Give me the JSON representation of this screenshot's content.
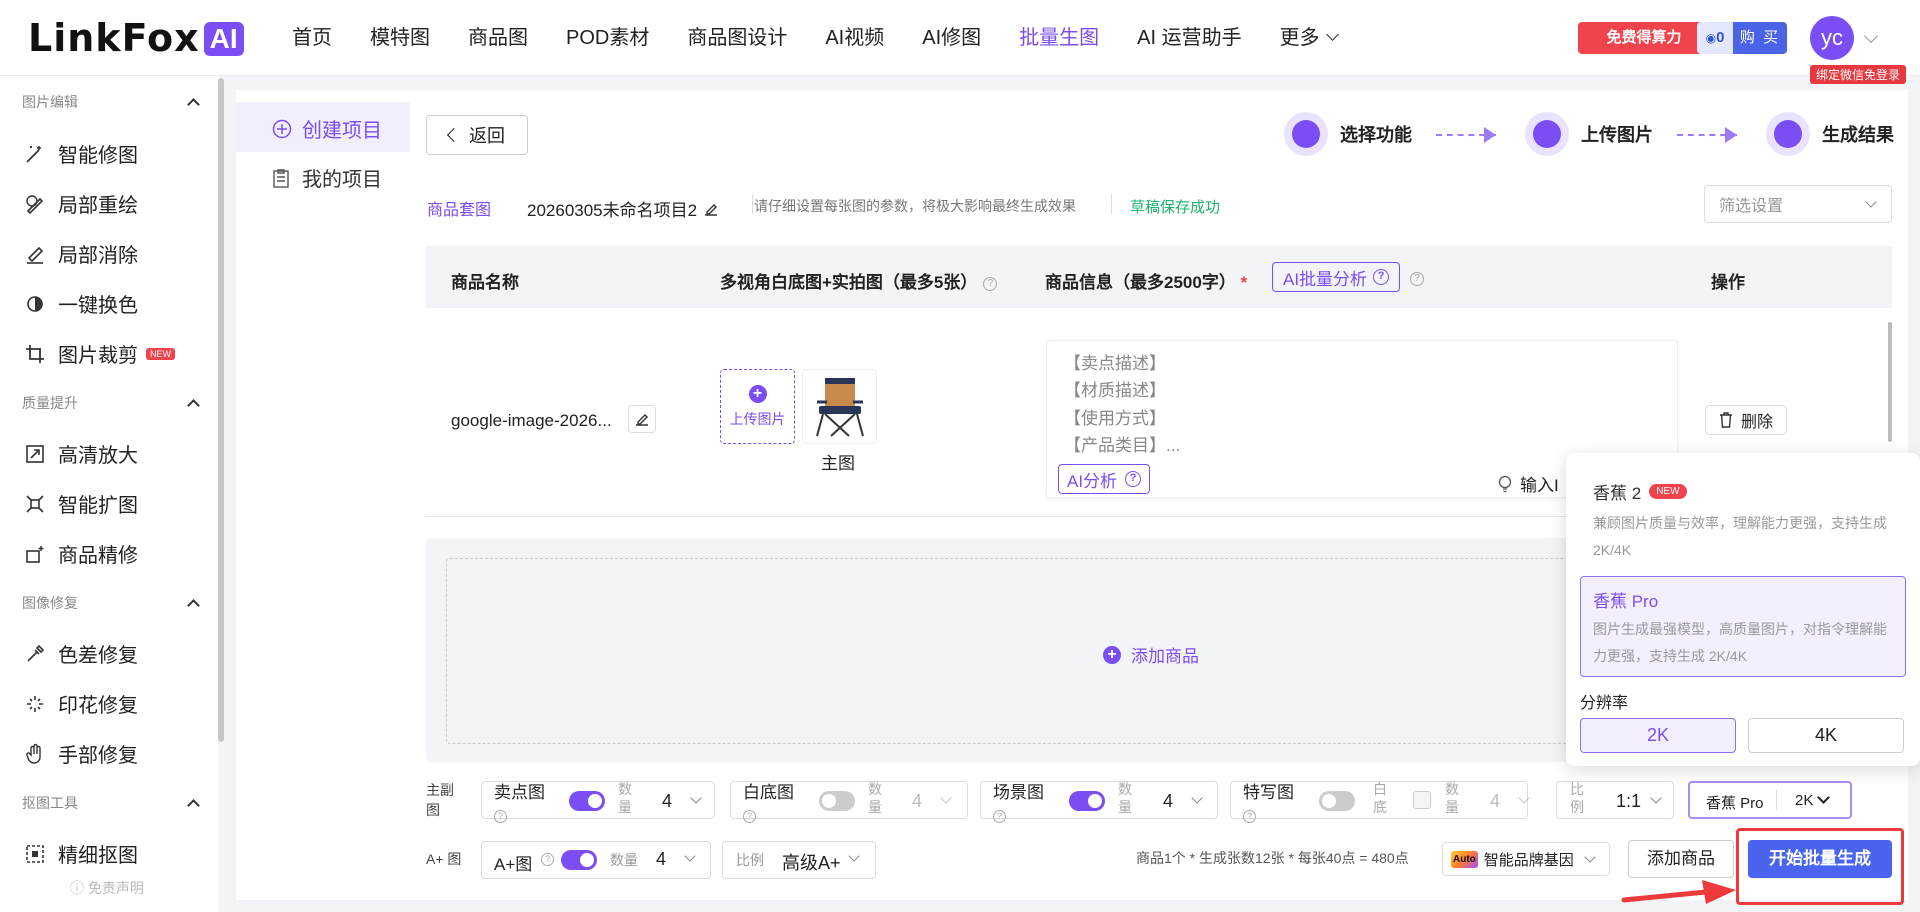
{
  "header": {
    "logo_text": "LinkFox",
    "logo_badge": "AI",
    "nav": [
      "首页",
      "模特图",
      "商品图",
      "POD素材",
      "商品图设计",
      "AI视频",
      "AI修图",
      "批量生图",
      "AI 运营助手",
      "更多"
    ],
    "active_nav": "批量生图",
    "free_button": "免费得算力",
    "credits": "0",
    "buy_label": "购 买",
    "avatar": "yc",
    "bind_tag": "绑定微信免登录"
  },
  "sidebar": {
    "sections": [
      {
        "title": "图片编辑",
        "items": [
          "智能修图",
          "局部重绘",
          "局部消除",
          "一键换色",
          "图片裁剪"
        ]
      },
      {
        "title": "质量提升",
        "items": [
          "高清放大",
          "智能扩图",
          "商品精修"
        ]
      },
      {
        "title": "图像修复",
        "items": [
          "色差修复",
          "印花修复",
          "手部修复"
        ]
      },
      {
        "title": "抠图工具",
        "items": [
          "精细抠图"
        ]
      }
    ],
    "new_badge": "NEW",
    "disclaimer": "免责声明"
  },
  "project_nav": {
    "create": "创建项目",
    "mine": "我的项目"
  },
  "toolbar": {
    "back": "返回",
    "steps": [
      "选择功能",
      "上传图片",
      "生成结果"
    ]
  },
  "project": {
    "tag": "商品套图",
    "name": "20260305未命名项目2",
    "hint": "请仔细设置每张图的参数，将极大影响最终生成效果",
    "saved": "草稿保存成功",
    "filter_placeholder": "筛选设置"
  },
  "table": {
    "headers": {
      "name": "商品名称",
      "images": "多视角白底图+实拍图（最多5张）",
      "info": "商品信息（最多2500字）",
      "required": "*",
      "ai_batch": "AI批量分析",
      "ops": "操作"
    },
    "row": {
      "name": "google-image-2026...",
      "upload": "上传图片",
      "main_label": "主图",
      "info_lines": [
        "【卖点描述】",
        "【材质描述】",
        "【使用方式】",
        "【产品类目】..."
      ],
      "ai_analyze": "AI分析",
      "input_hint": "输入I",
      "delete": "删除"
    },
    "add_product": "添加商品"
  },
  "controls": {
    "main_label_line1": "主副",
    "main_label_line2": "图",
    "items": [
      {
        "title": "卖点图",
        "qty_label": "数量",
        "qty": "4",
        "on": true
      },
      {
        "title": "白底图",
        "qty_label": "数量",
        "qty": "4",
        "on": false
      },
      {
        "title": "场景图",
        "qty_label": "数量",
        "qty": "4",
        "on": true
      },
      {
        "title": "特写图",
        "extra_label": "白底",
        "qty_label": "数量",
        "qty": "4",
        "on": false
      }
    ],
    "ratio_label": "比例",
    "ratio": "1:1",
    "model": "香蕉 Pro",
    "resolution": "2K",
    "aplus_row_label": "A+ 图",
    "aplus_title": "A+图",
    "aplus_qty_label": "数量",
    "aplus_qty": "4",
    "aplus_ratio_label": "比例",
    "aplus_ratio": "高级A+",
    "calc": "商品1个 * 生成张数12张 * 每张40点 = 480点",
    "brand_badge": "Auto",
    "brand": "智能品牌基因",
    "add_product": "添加商品",
    "start": "开始批量生成"
  },
  "popup": {
    "option1_title": "香蕉 2",
    "option1_badge": "NEW",
    "option1_desc": "兼顾图片质量与效率，理解能力更强，支持生成 2K/4K",
    "option2_title": "香蕉 Pro",
    "option2_desc": "图片生成最强模型，高质量图片，对指令理解能力更强，支持生成 2K/4K",
    "resolution_label": "分辨率",
    "res_2k": "2K",
    "res_4k": "4K"
  },
  "colors": {
    "accent": "#7b4df5",
    "primary_button": "#4a64f0",
    "danger": "#f0434b",
    "success": "#19b36b"
  }
}
